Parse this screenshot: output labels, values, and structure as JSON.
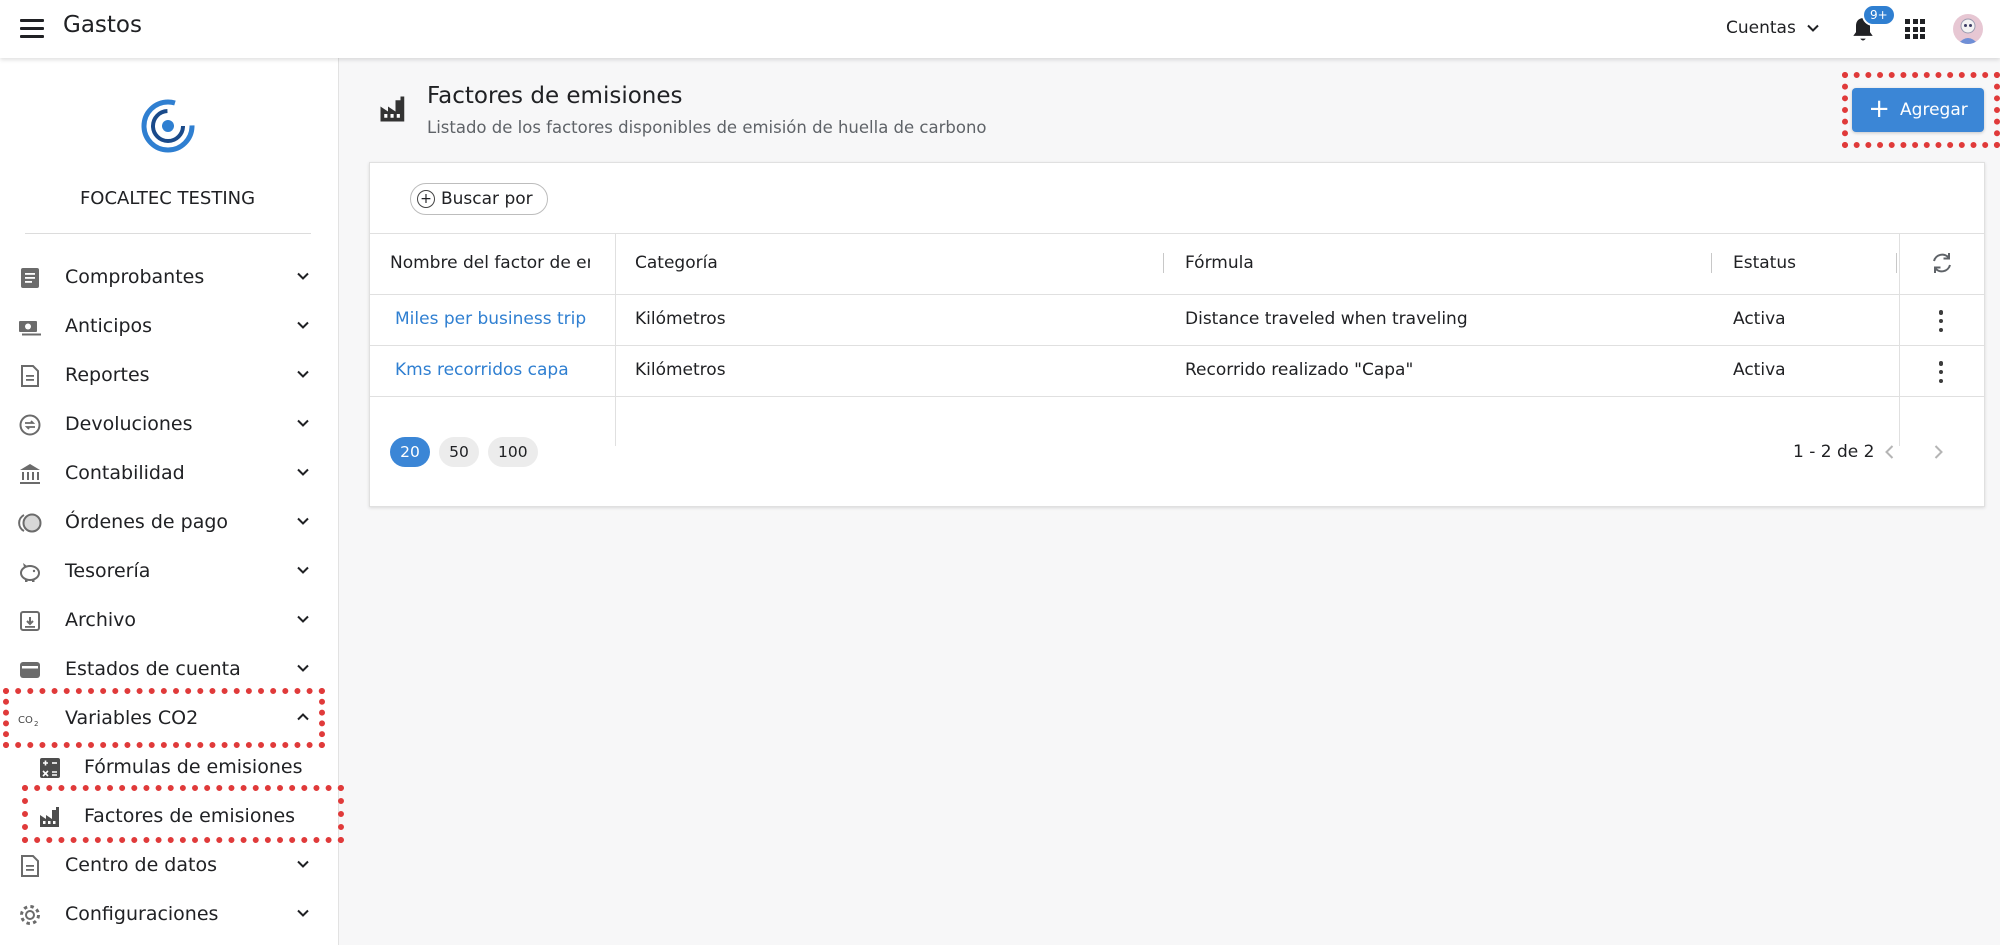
{
  "header": {
    "app_title": "Gastos",
    "accounts_label": "Cuentas",
    "notifications_badge": "9+"
  },
  "sidebar": {
    "company": "FOCALTEC TESTING",
    "items": [
      {
        "label": "Comprobantes",
        "icon": "document-icon"
      },
      {
        "label": "Anticipos",
        "icon": "cash-icon"
      },
      {
        "label": "Reportes",
        "icon": "report-icon"
      },
      {
        "label": "Devoluciones",
        "icon": "refund-icon"
      },
      {
        "label": "Contabilidad",
        "icon": "bank-icon"
      },
      {
        "label": "Órdenes de pago",
        "icon": "coins-icon"
      },
      {
        "label": "Tesorería",
        "icon": "piggy-bank-icon"
      },
      {
        "label": "Archivo",
        "icon": "archive-icon"
      },
      {
        "label": "Estados de cuenta",
        "icon": "wallet-icon"
      },
      {
        "label": "Variables CO2",
        "icon": "co2-icon",
        "expanded": true
      },
      {
        "label": "Centro de datos",
        "icon": "data-center-icon"
      },
      {
        "label": "Configuraciones",
        "icon": "gear-icon"
      }
    ],
    "sub_items": [
      {
        "label": "Fórmulas de emisiones",
        "icon": "calculator-icon"
      },
      {
        "label": "Factores de emisiones",
        "icon": "factory-icon",
        "active": true
      }
    ]
  },
  "page": {
    "title": "Factores de emisiones",
    "subtitle": "Listado de los factores disponibles de emisión de huella de carbono",
    "add_label": "Agregar",
    "search_label": "Buscar por"
  },
  "table": {
    "columns": [
      "Nombre del factor de emisión",
      "Categoría",
      "Fórmula",
      "Estatus"
    ],
    "rows": [
      {
        "name": "Miles per business trip",
        "category": "Kilómetros",
        "formula": "Distance traveled when traveling",
        "status": "Activa"
      },
      {
        "name": "Kms recorridos capa",
        "category": "Kilómetros",
        "formula": "Recorrido realizado \"Capa\"",
        "status": "Activa"
      }
    ]
  },
  "pagination": {
    "page_sizes": [
      "20",
      "50",
      "100"
    ],
    "selected_size": "20",
    "range": "1 - 2 de 2"
  },
  "colors": {
    "accent": "#3b86d6",
    "link": "#2f7fd1",
    "highlight": "#e03a3a"
  }
}
